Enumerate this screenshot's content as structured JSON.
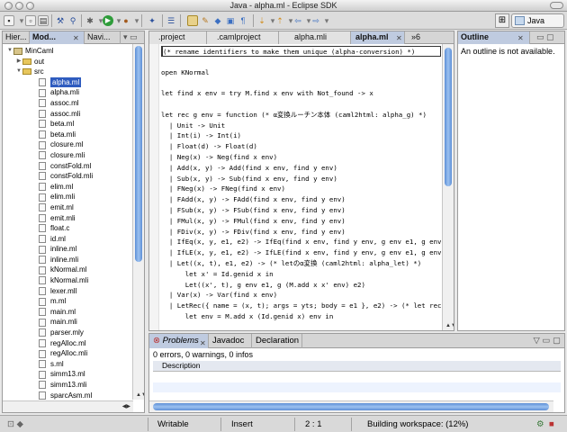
{
  "window": {
    "title": "Java - alpha.ml - Eclipse SDK"
  },
  "perspective": {
    "label": "Java"
  },
  "left_panel": {
    "tabs": [
      {
        "label": "Hier..."
      },
      {
        "label": "Mod..."
      },
      {
        "label": "Navi..."
      }
    ],
    "tree": {
      "project": "MinCaml",
      "folders": [
        "out",
        "src"
      ],
      "files": [
        "alpha.ml",
        "alpha.mli",
        "assoc.ml",
        "assoc.mli",
        "beta.ml",
        "beta.mli",
        "closure.ml",
        "closure.mli",
        "constFold.ml",
        "constFold.mli",
        "elim.ml",
        "elim.mli",
        "emit.ml",
        "emit.mli",
        "float.c",
        "id.ml",
        "inline.ml",
        "inline.mli",
        "kNormal.ml",
        "kNormal.mli",
        "lexer.mll",
        "m.ml",
        "main.ml",
        "main.mli",
        "parser.mly",
        "regAlloc.ml",
        "regAlloc.mli",
        "s.ml",
        "simm13.ml",
        "simm13.mli",
        "sparcAsm.ml"
      ],
      "selected": "alpha.ml"
    }
  },
  "editor": {
    "tabs": [
      {
        "label": ".project"
      },
      {
        "label": ".camlproject"
      },
      {
        "label": "alpha.mli"
      },
      {
        "label": "alpha.ml"
      }
    ],
    "overflow": "»6",
    "lines": [
      "(* rename identifiers to make them unique (alpha-conversion) *)",
      "",
      "open KNormal",
      "",
      "let find x env = try M.find x env with Not_found -> x",
      "",
      "let rec g env = function (* α変換ルーチン本体 (caml2html: alpha_g) *)",
      "  | Unit -> Unit",
      "  | Int(i) -> Int(i)",
      "  | Float(d) -> Float(d)",
      "  | Neg(x) -> Neg(find x env)",
      "  | Add(x, y) -> Add(find x env, find y env)",
      "  | Sub(x, y) -> Sub(find x env, find y env)",
      "  | FNeg(x) -> FNeg(find x env)",
      "  | FAdd(x, y) -> FAdd(find x env, find y env)",
      "  | FSub(x, y) -> FSub(find x env, find y env)",
      "  | FMul(x, y) -> FMul(find x env, find y env)",
      "  | FDiv(x, y) -> FDiv(find x env, find y env)",
      "  | IfEq(x, y, e1, e2) -> IfEq(find x env, find y env, g env e1, g env",
      "  | IfLE(x, y, e1, e2) -> IfLE(find x env, find y env, g env e1, g env",
      "  | Let((x, t), e1, e2) -> (* letのα変換 (caml2html: alpha_let) *)",
      "      let x' = Id.genid x in",
      "      Let((x', t), g env e1, g (M.add x x' env) e2)",
      "  | Var(x) -> Var(find x env)",
      "  | LetRec({ name = (x, t); args = yts; body = e1 }, e2) -> (* let rec",
      "      let env = M.add x (Id.genid x) env in"
    ]
  },
  "outline": {
    "tab": "Outline",
    "message": "An outline is not available."
  },
  "bottom_panel": {
    "tabs": [
      {
        "label": "Problems"
      },
      {
        "label": "Javadoc"
      },
      {
        "label": "Declaration"
      }
    ],
    "summary": "0 errors, 0 warnings, 0 infos",
    "column": "Description"
  },
  "status": {
    "mode": "Writable",
    "insert": "Insert",
    "position": "2 : 1",
    "task": "Building workspace: (12%)"
  },
  "colors": {
    "selection": "#2f5cbf",
    "active_tab": "#bfcbe0",
    "scroll_thumb": "#5d8fd6"
  }
}
